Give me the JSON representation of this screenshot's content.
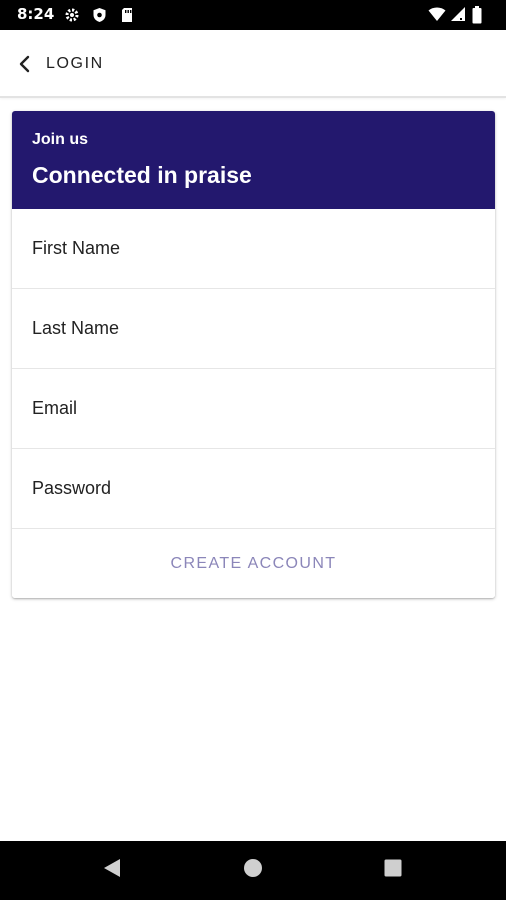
{
  "status_bar": {
    "time": "8:24",
    "left_icons": [
      "gear-icon",
      "shield-icon",
      "sd-card-icon"
    ],
    "right_icons": [
      "wifi-icon",
      "signal-icon",
      "battery-icon"
    ]
  },
  "app_bar": {
    "back_label": "LOGIN",
    "back_icon": "chevron-left-icon"
  },
  "card": {
    "eyebrow": "Join us",
    "title": "Connected in praise",
    "header_color": "#23186e",
    "fields": [
      {
        "placeholder": "First Name",
        "value": ""
      },
      {
        "placeholder": "Last Name",
        "value": ""
      },
      {
        "placeholder": "Email",
        "value": ""
      },
      {
        "placeholder": "Password",
        "value": ""
      }
    ],
    "submit_label": "CREATE ACCOUNT",
    "submit_color": "#8b86b9"
  },
  "nav_bar": {
    "icons": [
      "nav-back-icon",
      "nav-home-icon",
      "nav-recents-icon"
    ]
  }
}
